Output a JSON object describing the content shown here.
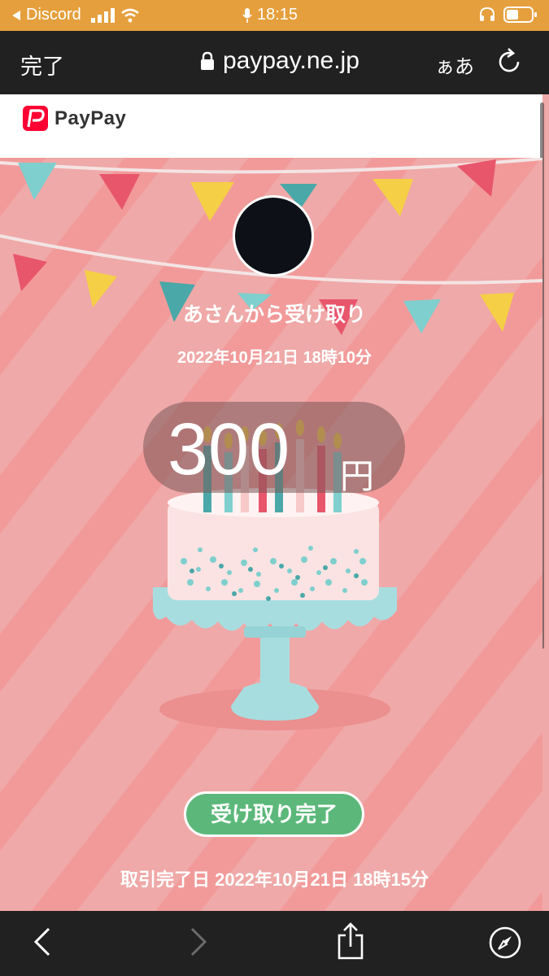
{
  "status_bar": {
    "back_app": "Discord",
    "time": "18:15"
  },
  "browser": {
    "done_label": "完了",
    "url": "paypay.ne.jp",
    "text_size_label": "ぁあ"
  },
  "header": {
    "logo_text": "PayPay"
  },
  "receipt": {
    "sender_text": "あさんから受け取り",
    "sent_date": "2022年10月21日 18時10分",
    "amount": "300",
    "currency": "円",
    "status_label": "受け取り完了",
    "completed_text": "取引完了日 2022年10月21日 18時15分"
  },
  "colors": {
    "background": "#efa9a8",
    "status_green": "#5cb87a",
    "status_bar": "#e59f3c",
    "chrome": "#212121"
  },
  "icons": [
    "back-arrow-icon",
    "signal-icon",
    "wifi-icon",
    "microphone-icon",
    "headphones-icon",
    "battery-icon",
    "lock-icon",
    "reload-icon",
    "chevron-left-icon",
    "chevron-right-icon",
    "share-icon",
    "compass-icon"
  ]
}
